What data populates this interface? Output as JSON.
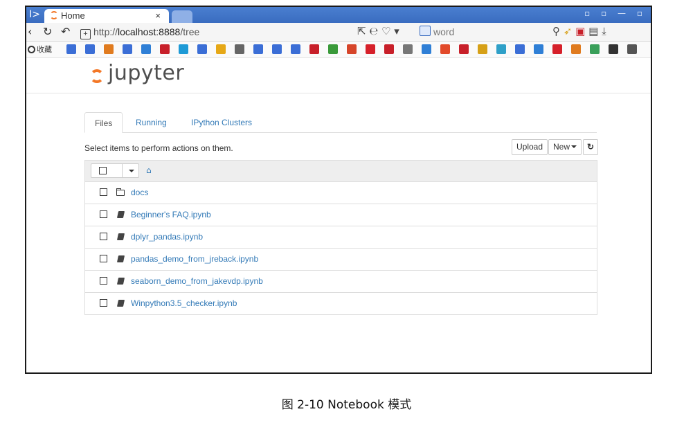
{
  "browser": {
    "tab_title": "Home",
    "tab_close": "×",
    "sidebar_toggle": "I>",
    "window_controls": "▫ ▫ — ▫",
    "url_scheme": "http://",
    "url_host": "localhost:8888",
    "url_path": "/tree",
    "search_text": "word",
    "bookmark_favorites_label": "收藏"
  },
  "bookmark_icon_colors": [
    "#3b6ed6",
    "#3b6ed6",
    "#e07b1f",
    "#3b6ed6",
    "#2f7fd6",
    "#c8202a",
    "#1e9ad6",
    "#3b6ed6",
    "#e6a817",
    "#666666",
    "#3b6ed6",
    "#3b6ed6",
    "#3b6ed6",
    "#c8202a",
    "#3a9a3a",
    "#d6452a",
    "#d6202a",
    "#c8202a",
    "#777777",
    "#2f7fd6",
    "#e24a2a",
    "#c8202a",
    "#d6a017",
    "#2fa0c8",
    "#3b6ed6",
    "#2f7fd6",
    "#d6202a",
    "#e07b1f",
    "#3aa05a",
    "#333333",
    "#555555"
  ],
  "jupyter": {
    "logo_text": "jupyter",
    "tabs": [
      {
        "label": "Files"
      },
      {
        "label": "Running"
      },
      {
        "label": "IPython Clusters"
      }
    ],
    "hint": "Select items to perform actions on them.",
    "upload_label": "Upload",
    "new_label": "New",
    "refresh_glyph": "↻",
    "home_glyph": "⌂",
    "items": [
      {
        "name": "docs",
        "type": "folder"
      },
      {
        "name": "Beginner's FAQ.ipynb",
        "type": "notebook"
      },
      {
        "name": "dplyr_pandas.ipynb",
        "type": "notebook"
      },
      {
        "name": "pandas_demo_from_jreback.ipynb",
        "type": "notebook"
      },
      {
        "name": "seaborn_demo_from_jakevdp.ipynb",
        "type": "notebook"
      },
      {
        "name": "Winpython3.5_checker.ipynb",
        "type": "notebook"
      }
    ]
  },
  "caption": "图 2-10 Notebook 模式",
  "colors": {
    "accent": "#f37726",
    "link": "#337ab7",
    "titlebar": "#3a6cc0"
  }
}
